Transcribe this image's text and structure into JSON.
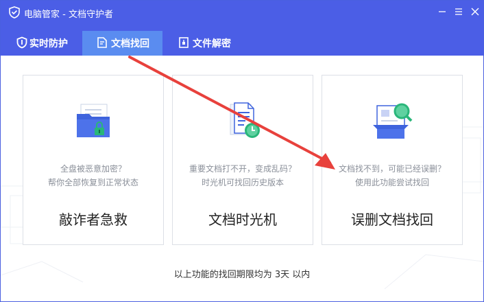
{
  "window": {
    "title": "电脑管家 - 文档守护者",
    "accent": "#4b5ee6",
    "active_tab_color": "#5a8cf0",
    "arrow_color": "#e8413c"
  },
  "tabs": [
    {
      "label": "实时防护",
      "icon": "shield-icon"
    },
    {
      "label": "文档找回",
      "icon": "document-recover-icon",
      "active": true
    },
    {
      "label": "文件解密",
      "icon": "file-lock-icon"
    }
  ],
  "cards": [
    {
      "icon": "locked-folder-icon",
      "desc_line1": "全盘被恶意加密？",
      "desc_line2": "帮你全部恢复到正常状态",
      "title": "敲诈者急救"
    },
    {
      "icon": "document-history-icon",
      "desc_line1": "重要文档打不开，变成乱码？",
      "desc_line2": "时光机可找回历史版本",
      "title": "文档时光机"
    },
    {
      "icon": "search-box-icon",
      "desc_line1": "文档找不到，可能已经误删？",
      "desc_line2": "使用此功能尝试找回",
      "title": "误删文档找回"
    }
  ],
  "footnote": "以上功能的找回期限均为 3天 以内"
}
